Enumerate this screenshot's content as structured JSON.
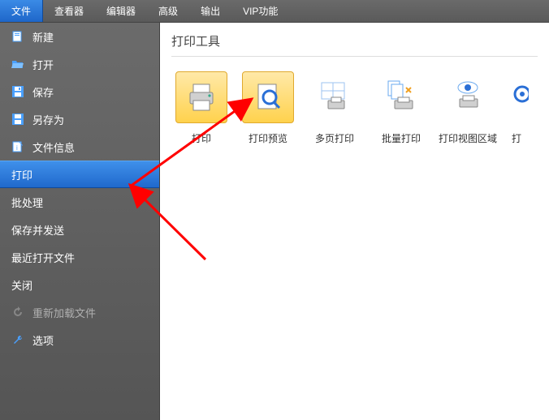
{
  "menu": {
    "items": [
      "文件",
      "查看器",
      "编辑器",
      "高级",
      "输出",
      "VIP功能"
    ],
    "active_index": 0
  },
  "sidebar": {
    "items": [
      {
        "label": "新建",
        "icon": "file-new-icon"
      },
      {
        "label": "打开",
        "icon": "folder-open-icon"
      },
      {
        "label": "保存",
        "icon": "save-icon"
      },
      {
        "label": "另存为",
        "icon": "save-as-icon"
      },
      {
        "label": "文件信息",
        "icon": "file-info-icon"
      },
      {
        "label": "打印",
        "icon": "",
        "selected": true
      },
      {
        "label": "批处理",
        "icon": ""
      },
      {
        "label": "保存并发送",
        "icon": ""
      },
      {
        "label": "最近打开文件",
        "icon": ""
      },
      {
        "label": "关闭",
        "icon": ""
      },
      {
        "label": "重新加载文件",
        "icon": "reload-icon",
        "disabled": true
      },
      {
        "label": "选项",
        "icon": "wrench-icon"
      }
    ]
  },
  "content": {
    "title": "打印工具",
    "tools": [
      {
        "label": "打印",
        "icon": "printer-icon",
        "style": "yellow"
      },
      {
        "label": "打印预览",
        "icon": "print-preview-icon",
        "style": "yellow"
      },
      {
        "label": "多页打印",
        "icon": "multipage-icon",
        "style": "plain"
      },
      {
        "label": "批量打印",
        "icon": "batch-print-icon",
        "style": "plain"
      },
      {
        "label": "打印视图区域",
        "icon": "print-view-area-icon",
        "style": "plain"
      },
      {
        "label": "打",
        "icon": "gear-icon",
        "style": "plain",
        "cut": true
      }
    ]
  }
}
